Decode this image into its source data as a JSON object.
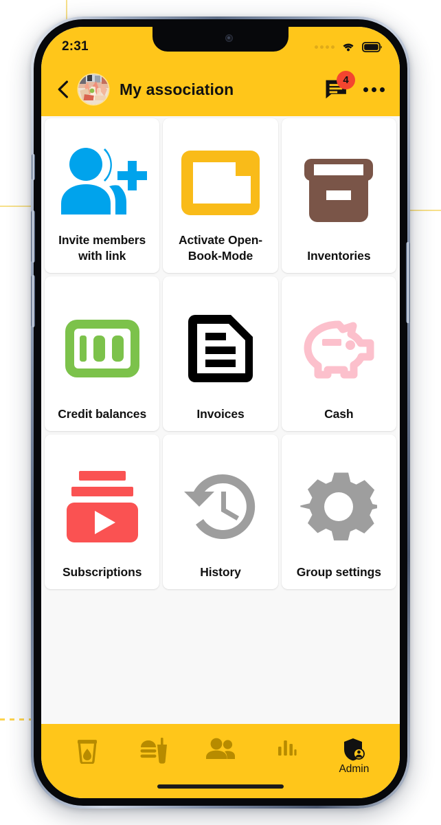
{
  "status_bar": {
    "time": "2:31",
    "signal_icon": "signal-dots-icon",
    "wifi_icon": "wifi-icon",
    "battery_icon": "battery-full-icon"
  },
  "app_bar": {
    "back_icon": "back-chevron-icon",
    "avatar_icon": "group-avatar-photo",
    "title": "My association",
    "messages_icon": "message-bubble-icon",
    "messages_badge": "4",
    "overflow_icon": "more-horizontal-icon"
  },
  "tiles": [
    {
      "label": "Invite members with link",
      "icon": "person-add-icon",
      "color": "#00a3ec"
    },
    {
      "label": "Activate Open-Book-Mode",
      "icon": "folder-icon",
      "color": "#f9bb19"
    },
    {
      "label": "Inventories",
      "icon": "archive-box-icon",
      "color": "#7a5548"
    },
    {
      "label": "Credit balances",
      "icon": "hundred-bill-icon",
      "color": "#7cc24b"
    },
    {
      "label": "Invoices",
      "icon": "document-lines-icon",
      "color": "#000000"
    },
    {
      "label": "Cash",
      "icon": "piggy-bank-icon",
      "color": "#fcc0cc"
    },
    {
      "label": "Subscriptions",
      "icon": "subscriptions-icon",
      "color": "#fa5252"
    },
    {
      "label": "History",
      "icon": "history-clock-icon",
      "color": "#9e9e9e"
    },
    {
      "label": "Group settings",
      "icon": "gear-icon",
      "color": "#9e9e9e"
    }
  ],
  "bottom_nav": [
    {
      "label": "",
      "icon": "drink-cup-icon",
      "active": false
    },
    {
      "label": "",
      "icon": "fast-food-icon",
      "active": false
    },
    {
      "label": "",
      "icon": "people-icon",
      "active": false
    },
    {
      "label": "",
      "icon": "bar-chart-icon",
      "active": false
    },
    {
      "label": "Admin",
      "icon": "shield-user-icon",
      "active": true
    }
  ],
  "colors": {
    "brand_yellow": "#ffc61a",
    "nav_inactive": "#b78b00",
    "nav_active": "#111111",
    "badge_red": "#f4452f",
    "content_bg": "#f8f8f8"
  }
}
